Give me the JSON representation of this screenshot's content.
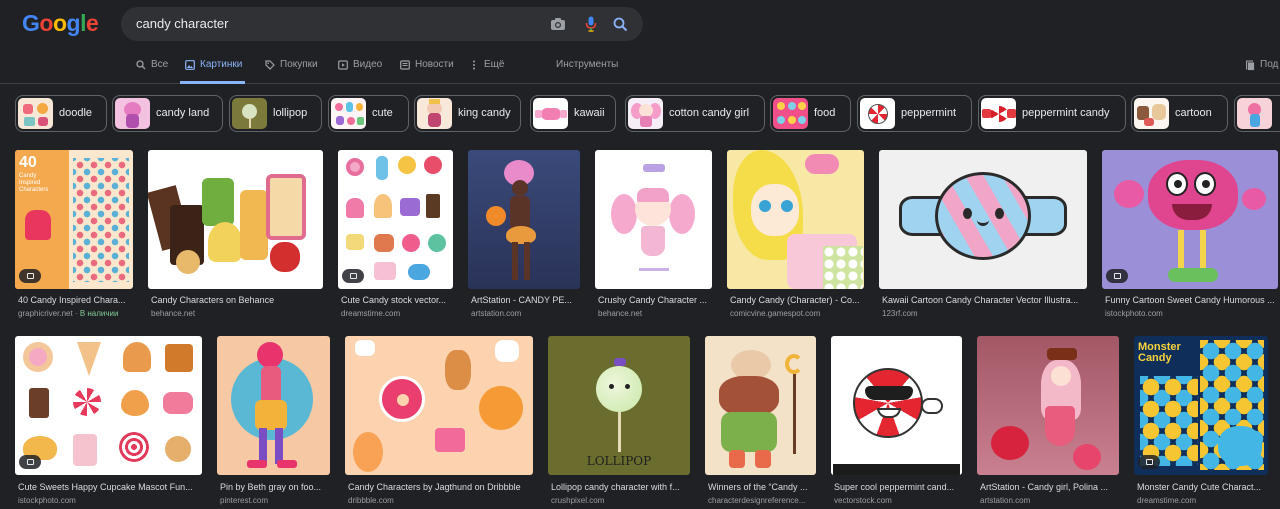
{
  "search": {
    "query": "candy character"
  },
  "logo": {
    "letters": [
      "G",
      "o",
      "o",
      "g",
      "l",
      "e"
    ],
    "colors": [
      "#4285f4",
      "#ea4335",
      "#fbbc05",
      "#4285f4",
      "#34a853",
      "#ea4335"
    ]
  },
  "tabs": [
    {
      "label": "Все",
      "icon": "search-icon"
    },
    {
      "label": "Картинки",
      "icon": "image-icon",
      "active": true
    },
    {
      "label": "Покупки",
      "icon": "tag-icon"
    },
    {
      "label": "Видео",
      "icon": "play-icon"
    },
    {
      "label": "Новости",
      "icon": "news-icon"
    },
    {
      "label": "Ещё",
      "icon": "more-icon"
    }
  ],
  "tools_label": "Инструменты",
  "saved_label": "Под",
  "chips": [
    {
      "label": "doodle"
    },
    {
      "label": "candy land"
    },
    {
      "label": "lollipop"
    },
    {
      "label": "cute"
    },
    {
      "label": "king candy"
    },
    {
      "label": "kawaii"
    },
    {
      "label": "cotton candy girl"
    },
    {
      "label": "food"
    },
    {
      "label": "peppermint"
    },
    {
      "label": "peppermint candy"
    },
    {
      "label": "cartoon"
    }
  ],
  "results": [
    {
      "caption": "40 Candy Inspired Chara...",
      "source": "graphicriver.net",
      "availability": "В наличии",
      "badge": "tag-icon",
      "overlay_title": "40",
      "overlay_sub": "Candy Inspired Characters"
    },
    {
      "caption": "Candy Characters on Behance",
      "source": "behance.net"
    },
    {
      "caption": "Cute Candy stock vector...",
      "source": "dreamstime.com",
      "badge": "image-icon"
    },
    {
      "caption": "ArtStation - CANDY PE...",
      "source": "artstation.com"
    },
    {
      "caption": "Crushy Candy Character ...",
      "source": "behance.net"
    },
    {
      "caption": "Candy Candy (Character) - Co...",
      "source": "comicvine.gamespot.com"
    },
    {
      "caption": "Kawaii Cartoon Candy Character Vector Illustra...",
      "source": "123rf.com"
    },
    {
      "caption": "Funny Cartoon Sweet Candy Humorous ...",
      "source": "istockphoto.com",
      "badge": "image-icon"
    },
    {
      "caption": "Cute Sweets Happy Cupcake Mascot Fun...",
      "source": "istockphoto.com",
      "badge": "image-icon"
    },
    {
      "caption": "Pin by Beth gray on foo...",
      "source": "pinterest.com"
    },
    {
      "caption": "Candy Characters by Jagthund on Dribbble",
      "source": "dribbble.com"
    },
    {
      "caption": "Lollipop candy character with f...",
      "source": "crushpixel.com",
      "overlay_title": "LOLLIPOP"
    },
    {
      "caption": "Winners of the “Candy ...",
      "source": "characterdesignreference..."
    },
    {
      "caption": "Super cool peppermint cand...",
      "source": "vectorstock.com"
    },
    {
      "caption": "ArtStation - Candy girl, Polina ...",
      "source": "artstation.com"
    },
    {
      "caption": "Monster Candy Cute Charact...",
      "source": "dreamstime.com",
      "badge": "image-icon",
      "overlay_title": "Monster Candy"
    }
  ]
}
